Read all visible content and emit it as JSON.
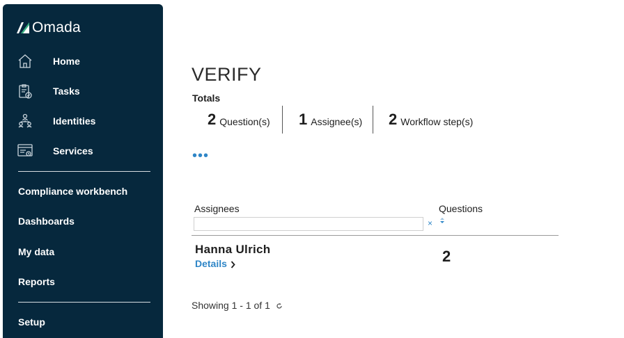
{
  "app": {
    "logo_text": "Omada"
  },
  "sidebar": {
    "primary": [
      {
        "label": "Home",
        "icon": "home-icon"
      },
      {
        "label": "Tasks",
        "icon": "tasks-icon"
      },
      {
        "label": "Identities",
        "icon": "identities-icon"
      },
      {
        "label": "Services",
        "icon": "services-icon"
      }
    ],
    "secondary": [
      {
        "label": "Compliance workbench"
      },
      {
        "label": "Dashboards"
      },
      {
        "label": "My data"
      },
      {
        "label": "Reports"
      }
    ],
    "tertiary": [
      {
        "label": "Setup"
      }
    ],
    "colors": {
      "background": "#06283d",
      "text": "#ffffff"
    }
  },
  "page": {
    "title": "VERIFY",
    "totals_label": "Totals",
    "stats": [
      {
        "value": "2",
        "label": "Question(s)"
      },
      {
        "value": "1",
        "label": "Assignee(s)"
      },
      {
        "value": "2",
        "label": "Workflow step(s)"
      }
    ],
    "more_label": "•••"
  },
  "grid": {
    "columns": {
      "assignees": "Assignees",
      "questions": "Questions"
    },
    "filter": {
      "value": "",
      "placeholder": "",
      "clear_label": "×"
    },
    "rows": [
      {
        "name": "Hanna Ulrich",
        "details_label": "Details",
        "questions": "2"
      }
    ],
    "footer": {
      "prefix": "Showing ",
      "range": "1 - 1",
      "of": " of ",
      "total": "1"
    }
  },
  "accent_color": "#2f86c7"
}
